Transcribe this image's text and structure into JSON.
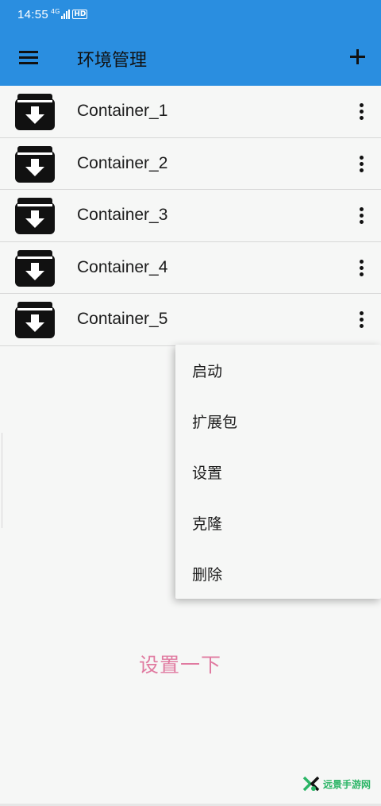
{
  "status_bar": {
    "time": "14:55",
    "network": "4G",
    "hd": "HD"
  },
  "app_bar": {
    "title": "环境管理",
    "menu_icon": "hamburger-menu-icon",
    "add_icon": "plus-icon"
  },
  "containers": [
    {
      "name": "Container_1",
      "icon": "archive-download-icon"
    },
    {
      "name": "Container_2",
      "icon": "archive-download-icon"
    },
    {
      "name": "Container_3",
      "icon": "archive-download-icon"
    },
    {
      "name": "Container_4",
      "icon": "archive-download-icon"
    },
    {
      "name": "Container_5",
      "icon": "archive-download-icon"
    }
  ],
  "context_menu": {
    "items": [
      "启动",
      "扩展包",
      "设置",
      "克隆",
      "删除"
    ]
  },
  "caption": "设置一下",
  "watermark": "远景手游网",
  "colors": {
    "app_bar": "#2a8ee0",
    "caption": "#e07aa0",
    "watermark": "#2bb566"
  }
}
